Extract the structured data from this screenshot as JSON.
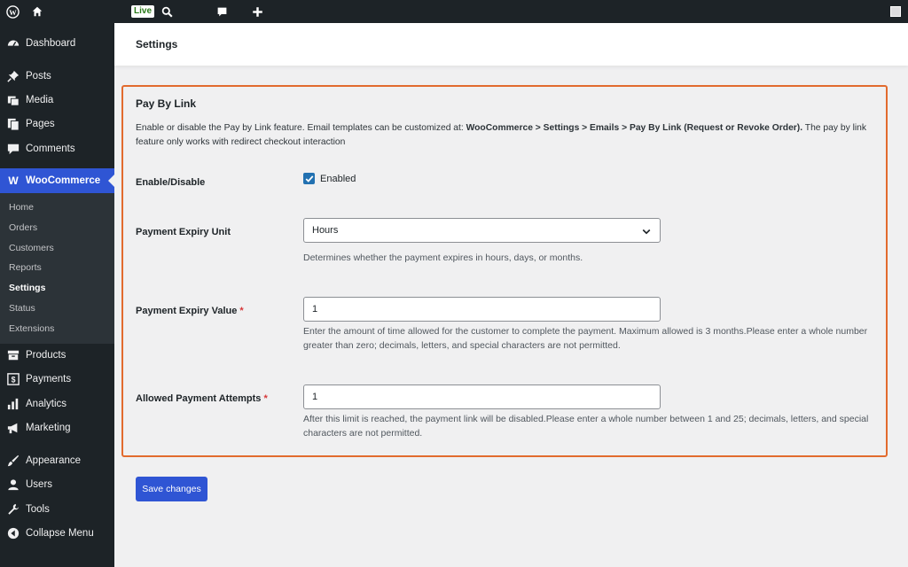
{
  "adminbar": {
    "icons": [
      "wordpress-icon",
      "home-icon",
      "search-icon",
      "comment-icon",
      "plus-icon",
      "avatar"
    ],
    "live_label": "Live"
  },
  "sidebar": {
    "items_top": [
      {
        "label": "Dashboard",
        "icon": "dashboard-icon"
      },
      {
        "label": "Posts",
        "icon": "pin-icon"
      },
      {
        "label": "Media",
        "icon": "media-icon"
      },
      {
        "label": "Pages",
        "icon": "pages-icon"
      },
      {
        "label": "Comments",
        "icon": "comment-icon"
      }
    ],
    "active": {
      "label": "WooCommerce",
      "icon": "woocommerce-icon"
    },
    "submenu": [
      "Home",
      "Orders",
      "Customers",
      "Reports",
      "Settings",
      "Status",
      "Extensions"
    ],
    "submenu_current": "Settings",
    "items_bottom": [
      {
        "label": "Products",
        "icon": "products-icon"
      },
      {
        "label": "Payments",
        "icon": "payments-icon"
      },
      {
        "label": "Analytics",
        "icon": "analytics-icon"
      },
      {
        "label": "Marketing",
        "icon": "megaphone-icon"
      },
      {
        "label": "Appearance",
        "icon": "brush-icon"
      },
      {
        "label": "Users",
        "icon": "users-icon"
      },
      {
        "label": "Tools",
        "icon": "wrench-icon"
      },
      {
        "label": "Collapse Menu",
        "icon": "collapse-icon"
      }
    ]
  },
  "header": {
    "title": "Settings"
  },
  "panel": {
    "title": "Pay By Link",
    "desc_pre": "Enable or disable the Pay by Link feature. Email templates can be customized at: ",
    "desc_bold": "WooCommerce > Settings > Emails > Pay By Link (Request or Revoke Order).",
    "desc_post": " The pay by link feature only works with redirect checkout interaction",
    "enable": {
      "label": "Enable/Disable",
      "checkbox_label": "Enabled",
      "checked": true
    },
    "expiry_unit": {
      "label": "Payment Expiry Unit",
      "value": "Hours",
      "help": "Determines whether the payment expires in hours, days, or months."
    },
    "expiry_value": {
      "label": "Payment Expiry Value",
      "required": "*",
      "value": "1",
      "help": "Enter the amount of time allowed for the customer to complete the payment. Maximum allowed is 3 months.Please enter a whole number greater than zero; decimals, letters, and special characters are not permitted."
    },
    "attempts": {
      "label": "Allowed Payment Attempts",
      "required": "*",
      "value": "1",
      "help": "After this limit is reached, the payment link will be disabled.Please enter a whole number between 1 and 25; decimals, letters, and special characters are not permitted."
    }
  },
  "save_label": "Save changes",
  "colors": {
    "accent": "#2f55d4",
    "panel_border": "#e26b2e",
    "sidebar_bg": "#1d2327",
    "required": "#d63638"
  }
}
